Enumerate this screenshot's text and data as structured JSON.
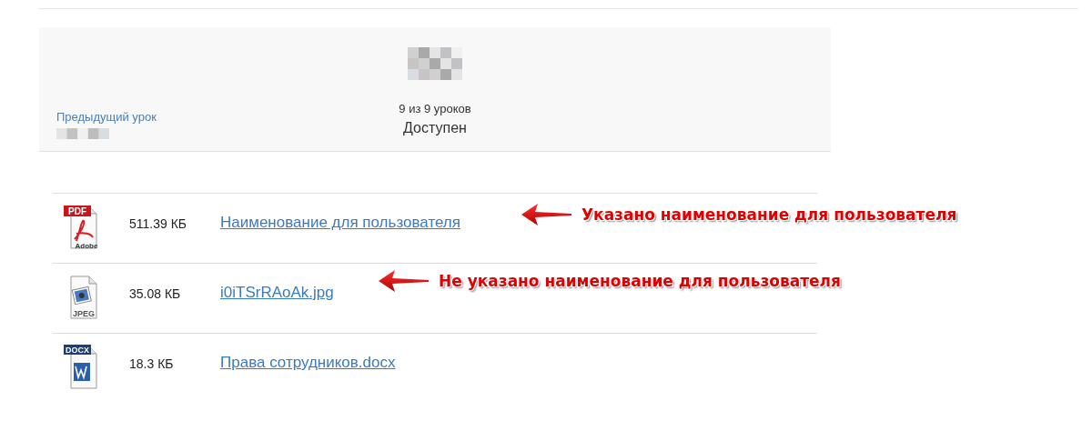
{
  "lesson_nav": {
    "previous_link": "Предыдущий урок",
    "progress": "9 из 9 уроков",
    "status": "Доступен"
  },
  "files": [
    {
      "kind": "pdf",
      "icon_label": "PDF",
      "icon_sublabel": "Adobe",
      "size": "511.39 КБ",
      "name": "Наименование для пользователя"
    },
    {
      "kind": "jpeg",
      "icon_label": "JPEG",
      "size": "35.08 КБ",
      "name": "i0iTSrRAoAk.jpg"
    },
    {
      "kind": "docx",
      "icon_label": "DOCX",
      "size": "18.3 КБ",
      "name": "Права сотрудников.docx"
    }
  ],
  "annotations": [
    {
      "text": "Указано наименование для пользователя"
    },
    {
      "text": "Не указано наименование для пользователя"
    }
  ]
}
